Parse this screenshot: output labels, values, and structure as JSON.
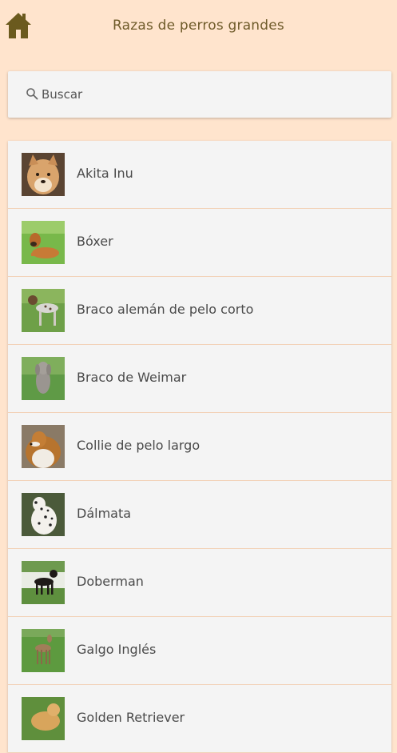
{
  "header": {
    "title": "Razas de perros grandes",
    "home_icon": "home-icon"
  },
  "search": {
    "placeholder": "Buscar",
    "value": ""
  },
  "breeds": [
    {
      "name": "Akita Inu",
      "icon": "akita-inu-photo"
    },
    {
      "name": "Bóxer",
      "icon": "boxer-photo"
    },
    {
      "name": "Braco alemán de pelo corto",
      "icon": "braco-aleman-photo"
    },
    {
      "name": "Braco de Weimar",
      "icon": "braco-weimar-photo"
    },
    {
      "name": "Collie de pelo largo",
      "icon": "collie-photo"
    },
    {
      "name": "Dálmata",
      "icon": "dalmata-photo"
    },
    {
      "name": "Doberman",
      "icon": "doberman-photo"
    },
    {
      "name": "Galgo Inglés",
      "icon": "galgo-ingles-photo"
    },
    {
      "name": "Golden Retriever",
      "icon": "golden-retriever-photo"
    }
  ],
  "colors": {
    "background": "#ffe4cd",
    "title": "#6f5b2a",
    "home_icon": "#6b5a1e",
    "card": "#f4f4f4",
    "divider": "#f2d2b8"
  }
}
